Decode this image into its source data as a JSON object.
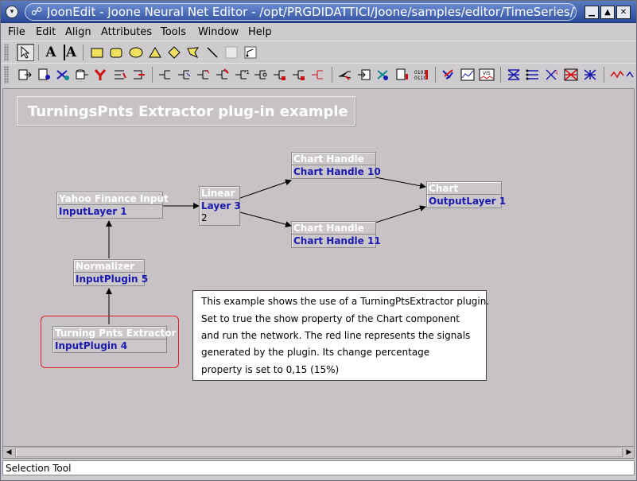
{
  "window": {
    "title": "JoonEdit - Joone Neural Net Editor - /opt/PRGDIDATTICI/Joone/samples/editor/TimeSeries/Turnin",
    "buttons": {
      "minimize": "▁",
      "maximize": "▲",
      "close": "✕"
    }
  },
  "menubar": {
    "items": [
      {
        "label": "File"
      },
      {
        "label": "Edit"
      },
      {
        "label": "Align"
      },
      {
        "label": "Attributes"
      },
      {
        "label": "Tools"
      },
      {
        "label": "Window"
      },
      {
        "label": "Help"
      }
    ]
  },
  "toolbar1": {
    "tools": [
      {
        "icon": "selection-arrow-icon",
        "glyph": "↖"
      },
      {
        "icon": "text-tool-icon",
        "glyph": "A"
      },
      {
        "icon": "text-area-tool-icon",
        "glyph": "A"
      },
      {
        "icon": "rectangle-tool-icon",
        "glyph": "▭"
      },
      {
        "icon": "rounded-rectangle-tool-icon",
        "glyph": "▢"
      },
      {
        "icon": "ellipse-tool-icon",
        "glyph": "⬭"
      },
      {
        "icon": "triangle-tool-icon",
        "glyph": "△"
      },
      {
        "icon": "diamond-tool-icon",
        "glyph": "◇"
      },
      {
        "icon": "polygon-tool-icon",
        "glyph": "⬠"
      },
      {
        "icon": "line-tool-icon",
        "glyph": "╲"
      },
      {
        "icon": "blank-tool-icon",
        "glyph": ""
      },
      {
        "icon": "connection-tool-icon",
        "glyph": "↗"
      }
    ]
  },
  "toolbar2": {
    "groups": [
      [
        "input-layer-icon",
        "file-input-icon",
        "url-input-icon",
        "db-input-icon",
        "yahoo-input-icon",
        "excel-input-icon",
        "memory-input-icon"
      ],
      [
        "linear-layer-icon",
        "sigmoid-layer-icon",
        "tanh-layer-icon",
        "log-layer-icon",
        "delay-layer-icon",
        "context-layer-icon",
        "winner-layer-icon",
        "gauss-layer-icon",
        "sine-layer-icon"
      ],
      [
        "switch-icon",
        "output-icon",
        "teacher-icon",
        "file-output-icon",
        "monitor-output-icon"
      ],
      [
        "chart-handle-icon",
        "chart-icon",
        "vis-icon"
      ],
      [
        "full-synapse-icon",
        "direct-synapse-icon",
        "delay-synapse-icon",
        "kohonen-synapse-icon",
        "sanger-synapse-icon"
      ],
      [
        "plugin-icon",
        "normalizer-icon"
      ]
    ]
  },
  "canvas": {
    "title": "TurningsPnts Extractor plug-in example",
    "nodes": {
      "yahoo": {
        "header": "Yahoo Finance Input",
        "name": "InputLayer 1"
      },
      "linear": {
        "header": "Linear",
        "name": "Layer 3",
        "extra": "2"
      },
      "chart_handle_10": {
        "header": "Chart Handle",
        "name": "Chart Handle 10"
      },
      "chart_handle_11": {
        "header": "Chart Handle",
        "name": "Chart Handle 11"
      },
      "chart": {
        "header": "Chart",
        "name": "OutputLayer 1"
      },
      "normalizer": {
        "header": "Normalizer",
        "name": "InputPlugin 5"
      },
      "turning": {
        "header": "Turning Pnts Extractor",
        "name": "InputPlugin 4"
      }
    },
    "note": {
      "lines": [
        "This example shows the use of a TurningPtsExtractor plugin.",
        "Set to true the show property of the Chart component",
        "and run the network. The red line represents the signals",
        "generated by the plugin. Its change percentage",
        "property is set to 0,15 (15%)"
      ]
    }
  },
  "status": {
    "text": "Selection Tool"
  },
  "colors": {
    "accent_blue": "#1a1ab0",
    "title_bar": "#2a4a98",
    "selection_red": "#e02020"
  }
}
